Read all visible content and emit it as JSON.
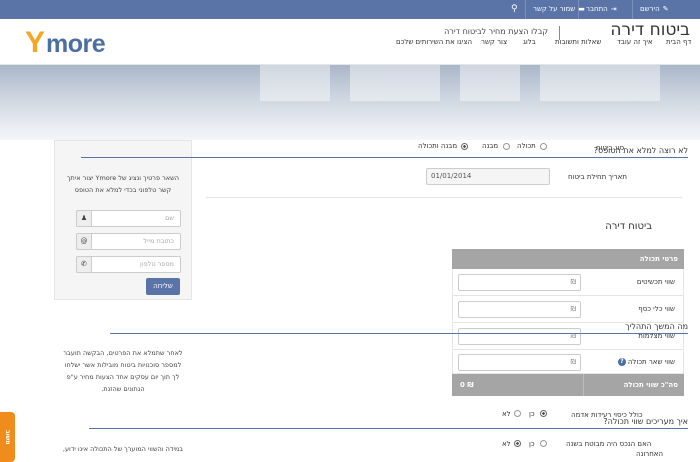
{
  "topbar": {
    "register": "הירשם",
    "login": "התחבר",
    "contact": "שמור על קשר"
  },
  "logo": {
    "y": "Y",
    "more": "more"
  },
  "nav": {
    "home": "דף הבית",
    "how": "איך זה עובד",
    "faq": "שאלות ותשובות",
    "blog": "בלוג",
    "contact": "צור קשר",
    "services": "הציגו את השירותים שלכם"
  },
  "hero": {
    "title": "ביטוח דירה",
    "subtitle": "קבלו הצעת מחיר לביטוח דירה"
  },
  "form": {
    "insurance_type_label": "סוג ביטוח",
    "options": [
      "תכולה",
      "מבנה",
      "מבנה ותכולה"
    ],
    "start_date_label": "תאריך תחילת ביטוח",
    "start_date_value": "01/01/2014"
  },
  "section_title": "ביטוח דירה",
  "table": {
    "header": "פרטי תכולה",
    "currency": "₪",
    "rows": [
      "שווי תכשיטים",
      "שווי כלי כסף",
      "שווי מצלמות",
      "שווי שאר תכולה"
    ],
    "help_icon": "?",
    "total_label": "סה\"כ שווי תכולה",
    "total_value": "0 ₪"
  },
  "questions": {
    "q1": "כולל כיסוי רעידות אדמה",
    "q2_line1": "האם הנכס היה מבוטח בשנה",
    "q2_line2": "האחרונה",
    "yes": "כן",
    "no": "לא"
  },
  "sidebar": {
    "lazy_title": "לא רוצה למלא את הטופס?",
    "lazy_text_1": "השאר פרטיך ונציג של Ymore יצור איתך",
    "lazy_text_2": "קשר טלפוני בכדי למלא את הטופס",
    "name_placeholder": "שם",
    "email_placeholder": "כתובת מייל",
    "phone_placeholder": "מספר טלפון",
    "send_button": "שליחה",
    "process_title": "מה המשך התהליך",
    "process_text_1": "לאחר שתמלא את הפרטים, הבקשה תועבר",
    "process_text_2": "למספר סוכנויות ביטוח מובילות אשר ישלחו",
    "process_text_3": "לך תוך יום עסקים אחד הצעות מחיר ע\"פ",
    "process_text_4": "הנתונים שהזנת.",
    "value_title": "איך מעריכים שווי תכולה?",
    "value_text_1": "במידה והשווי המוערך של התכולה אינו ידוע,"
  },
  "feedback": "משוב"
}
